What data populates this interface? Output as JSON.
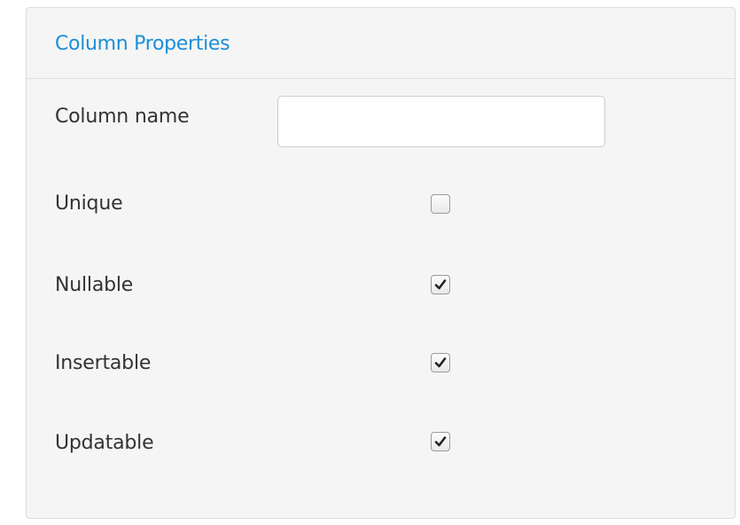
{
  "panel": {
    "title": "Column Properties"
  },
  "fields": {
    "column_name": {
      "label": "Column name",
      "value": "",
      "placeholder": ""
    },
    "unique": {
      "label": "Unique",
      "checked": false
    },
    "nullable": {
      "label": "Nullable",
      "checked": true
    },
    "insertable": {
      "label": "Insertable",
      "checked": true
    },
    "updatable": {
      "label": "Updatable",
      "checked": true
    }
  },
  "colors": {
    "title": "#1b8fd6",
    "panel_bg": "#f5f5f5",
    "label": "#333333"
  }
}
